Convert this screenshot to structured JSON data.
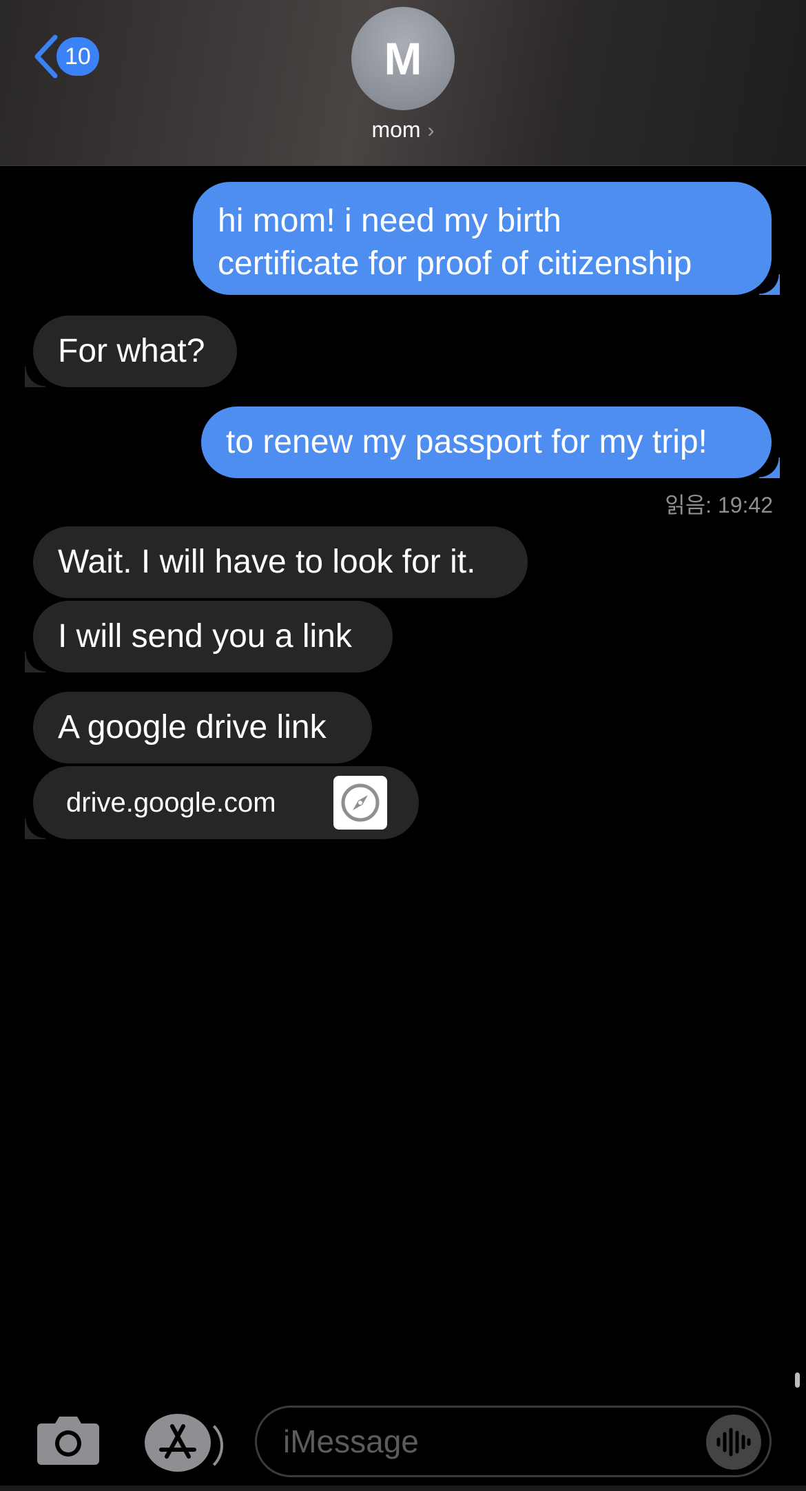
{
  "header": {
    "back_badge": "10",
    "avatar_initial": "M",
    "contact_name": "mom",
    "contact_chevron": "›"
  },
  "messages": [
    {
      "direction": "out",
      "line1": "hi mom! i need my birth",
      "line2": "certificate for proof of citizenship"
    },
    {
      "direction": "in",
      "text": "For what?"
    },
    {
      "direction": "out",
      "text": "to renew my passport for my trip!"
    },
    {
      "direction": "in",
      "text": "Wait. I will have to look for it."
    },
    {
      "direction": "in",
      "text": "I will send you a link"
    },
    {
      "direction": "in",
      "text": "A google drive link"
    },
    {
      "direction": "in",
      "type": "link-preview",
      "text": "drive.google.com",
      "icon": "compass-icon"
    }
  ],
  "read_receipt": "읽음: 19:42",
  "composer": {
    "placeholder": "iMessage",
    "value": "",
    "icons": [
      "camera-icon",
      "app-store-icon",
      "audio-waveform-icon"
    ]
  },
  "colors": {
    "outgoing": "#4d8ef0",
    "incoming": "#262628",
    "accent": "#3b82f6",
    "background": "#000000"
  }
}
